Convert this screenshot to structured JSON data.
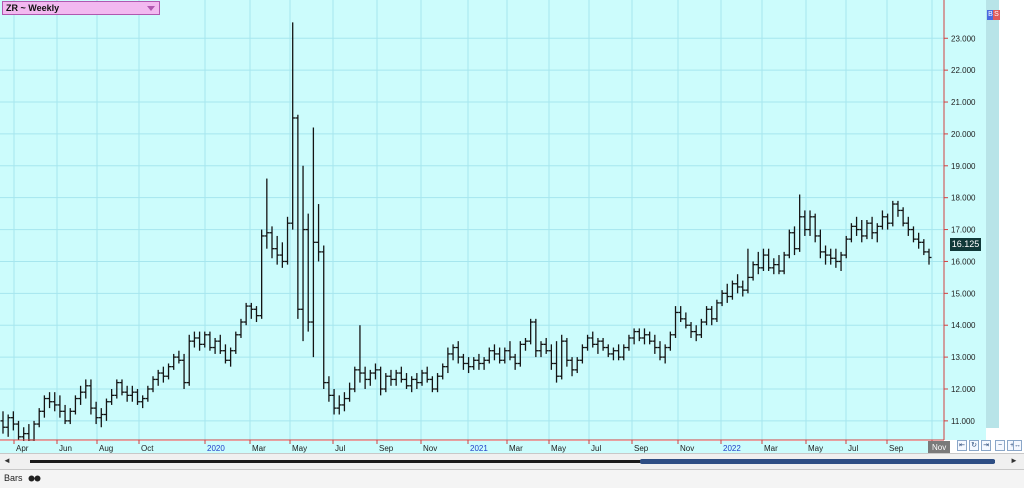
{
  "window": {
    "title": "ZR ~ Weekly"
  },
  "price_marker": {
    "value_label": "16.125",
    "badge_color": "#103838"
  },
  "corner_badges": [
    "B",
    "S"
  ],
  "x_axis_labels": [
    "Apr",
    "Jun",
    "Aug",
    "Oct",
    "2020",
    "Mar",
    "May",
    "Jul",
    "Sep",
    "Nov",
    "2021",
    "Mar",
    "May",
    "Jul",
    "Sep",
    "Nov",
    "2022",
    "Mar",
    "May",
    "Jul",
    "Sep",
    "Nov"
  ],
  "bottom": {
    "tab_label": "Bars",
    "tab_icon": "binoculars-icon"
  },
  "scrollbar": {
    "left_arrow": "◄",
    "right_arrow": "►"
  },
  "nav_buttons": [
    {
      "icon": "step-back-icon",
      "glyph": "⇤"
    },
    {
      "icon": "refresh-icon",
      "glyph": "↻"
    },
    {
      "icon": "step-forward-icon",
      "glyph": "⇥"
    },
    {
      "icon": "zoom-out-icon",
      "glyph": "−"
    },
    {
      "icon": "zoom-in-icon",
      "glyph": "+"
    },
    {
      "icon": "fit-icon",
      "glyph": "↔"
    }
  ],
  "colors": {
    "plot_bg": "#ccfcfc",
    "grid": "#a6e6ee",
    "bar": "#141414",
    "axis_red": "#d04040",
    "year_label": "#2040c8",
    "label": "#222222",
    "price_scale_bg": "#ccfcfc",
    "right_panel": "#b8e4e8"
  },
  "chart_data": {
    "type": "ohlc-bar",
    "title": "ZR ~ Weekly",
    "ylim": [
      10.4,
      24.2
    ],
    "y_ticks": [
      "11.000",
      "12.000",
      "13.000",
      "14.000",
      "15.000",
      "16.000",
      "17.000",
      "18.000",
      "19.000",
      "20.000",
      "21.000",
      "22.000",
      "23.000"
    ],
    "x_ticks": [
      "Apr",
      "Jun",
      "Aug",
      "Oct",
      "2020",
      "Mar",
      "May",
      "Jul",
      "Sep",
      "Nov",
      "2021",
      "Mar",
      "May",
      "Jul",
      "Sep",
      "Nov",
      "2022",
      "Mar",
      "May",
      "Jul",
      "Sep",
      "Nov"
    ],
    "last_price": 16.125,
    "bars": [
      [
        11.0,
        11.3,
        10.6,
        10.8
      ],
      [
        10.8,
        11.2,
        10.5,
        11.1
      ],
      [
        11.1,
        11.3,
        10.7,
        10.9
      ],
      [
        10.9,
        11.0,
        10.4,
        10.5
      ],
      [
        10.5,
        10.8,
        10.2,
        10.6
      ],
      [
        10.6,
        10.9,
        10.3,
        10.4
      ],
      [
        10.4,
        11.0,
        10.3,
        10.9
      ],
      [
        10.9,
        11.4,
        10.8,
        11.3
      ],
      [
        11.3,
        11.8,
        11.1,
        11.7
      ],
      [
        11.7,
        11.9,
        11.4,
        11.6
      ],
      [
        11.6,
        11.9,
        11.3,
        11.5
      ],
      [
        11.5,
        11.8,
        11.1,
        11.3
      ],
      [
        11.3,
        11.5,
        10.9,
        11.0
      ],
      [
        11.0,
        11.4,
        10.9,
        11.3
      ],
      [
        11.3,
        11.8,
        11.2,
        11.7
      ],
      [
        11.7,
        12.1,
        11.5,
        11.9
      ],
      [
        11.9,
        12.3,
        11.7,
        12.1
      ],
      [
        12.1,
        12.3,
        11.2,
        11.4
      ],
      [
        11.4,
        11.6,
        10.9,
        11.1
      ],
      [
        11.1,
        11.4,
        10.8,
        11.2
      ],
      [
        11.2,
        11.7,
        11.0,
        11.6
      ],
      [
        11.6,
        12.0,
        11.5,
        11.8
      ],
      [
        11.8,
        12.3,
        11.7,
        12.2
      ],
      [
        12.2,
        12.3,
        11.8,
        11.9
      ],
      [
        11.9,
        12.1,
        11.6,
        11.8
      ],
      [
        11.8,
        12.1,
        11.6,
        11.9
      ],
      [
        11.9,
        12.0,
        11.5,
        11.6
      ],
      [
        11.6,
        11.8,
        11.4,
        11.7
      ],
      [
        11.7,
        12.1,
        11.6,
        12.0
      ],
      [
        12.0,
        12.4,
        11.9,
        12.3
      ],
      [
        12.3,
        12.6,
        12.1,
        12.5
      ],
      [
        12.5,
        12.7,
        12.2,
        12.4
      ],
      [
        12.4,
        12.8,
        12.3,
        12.7
      ],
      [
        12.7,
        13.1,
        12.6,
        13.0
      ],
      [
        13.0,
        13.2,
        12.8,
        12.9
      ],
      [
        12.9,
        13.1,
        12.0,
        12.2
      ],
      [
        12.2,
        13.7,
        12.1,
        13.5
      ],
      [
        13.5,
        13.8,
        13.3,
        13.6
      ],
      [
        13.6,
        13.8,
        13.2,
        13.4
      ],
      [
        13.4,
        13.8,
        13.3,
        13.7
      ],
      [
        13.7,
        13.8,
        13.2,
        13.3
      ],
      [
        13.3,
        13.6,
        13.1,
        13.5
      ],
      [
        13.5,
        13.7,
        13.1,
        13.2
      ],
      [
        13.2,
        13.4,
        12.8,
        12.9
      ],
      [
        12.9,
        13.3,
        12.7,
        13.2
      ],
      [
        13.2,
        13.8,
        13.1,
        13.7
      ],
      [
        13.7,
        14.2,
        13.6,
        14.1
      ],
      [
        14.1,
        14.7,
        14.0,
        14.6
      ],
      [
        14.6,
        14.7,
        14.2,
        14.5
      ],
      [
        14.5,
        14.6,
        14.1,
        14.3
      ],
      [
        14.3,
        17.0,
        14.2,
        16.8
      ],
      [
        16.8,
        18.6,
        16.4,
        16.9
      ],
      [
        16.9,
        17.1,
        16.1,
        16.4
      ],
      [
        16.4,
        16.8,
        15.9,
        16.2
      ],
      [
        16.2,
        16.6,
        15.8,
        16.0
      ],
      [
        16.0,
        17.4,
        15.9,
        17.2
      ],
      [
        17.2,
        23.5,
        17.0,
        20.5
      ],
      [
        20.5,
        20.6,
        14.2,
        14.5
      ],
      [
        14.5,
        19.0,
        13.5,
        17.0
      ],
      [
        17.0,
        17.5,
        13.8,
        14.1
      ],
      [
        14.1,
        20.2,
        13.0,
        16.6
      ],
      [
        16.6,
        17.8,
        16.0,
        16.3
      ],
      [
        16.3,
        16.5,
        12.0,
        12.2
      ],
      [
        12.2,
        12.4,
        11.6,
        11.8
      ],
      [
        11.8,
        12.0,
        11.2,
        11.4
      ],
      [
        11.4,
        11.8,
        11.2,
        11.5
      ],
      [
        11.5,
        11.9,
        11.3,
        11.7
      ],
      [
        11.7,
        12.2,
        11.6,
        12.0
      ],
      [
        12.0,
        12.7,
        11.9,
        12.6
      ],
      [
        12.6,
        14.0,
        12.2,
        12.5
      ],
      [
        12.5,
        12.7,
        12.0,
        12.3
      ],
      [
        12.3,
        12.6,
        12.1,
        12.5
      ],
      [
        12.5,
        12.8,
        12.3,
        12.6
      ],
      [
        12.6,
        12.7,
        11.8,
        12.0
      ],
      [
        12.0,
        12.5,
        11.9,
        12.4
      ],
      [
        12.4,
        12.6,
        12.1,
        12.3
      ],
      [
        12.3,
        12.6,
        12.1,
        12.5
      ],
      [
        12.5,
        12.7,
        12.2,
        12.3
      ],
      [
        12.3,
        12.5,
        12.0,
        12.1
      ],
      [
        12.1,
        12.4,
        11.9,
        12.3
      ],
      [
        12.3,
        12.5,
        12.0,
        12.2
      ],
      [
        12.2,
        12.6,
        12.1,
        12.5
      ],
      [
        12.5,
        12.7,
        12.2,
        12.3
      ],
      [
        12.3,
        12.4,
        11.9,
        12.0
      ],
      [
        12.0,
        12.5,
        11.9,
        12.4
      ],
      [
        12.4,
        12.8,
        12.3,
        12.7
      ],
      [
        12.7,
        13.3,
        12.5,
        13.1
      ],
      [
        13.1,
        13.4,
        12.9,
        13.3
      ],
      [
        13.3,
        13.5,
        12.8,
        13.0
      ],
      [
        13.0,
        13.1,
        12.6,
        12.8
      ],
      [
        12.8,
        13.0,
        12.5,
        12.7
      ],
      [
        12.7,
        13.0,
        12.6,
        12.9
      ],
      [
        12.9,
        13.1,
        12.6,
        12.8
      ],
      [
        12.8,
        13.0,
        12.6,
        12.9
      ],
      [
        12.9,
        13.3,
        12.8,
        13.2
      ],
      [
        13.2,
        13.4,
        12.9,
        13.1
      ],
      [
        13.1,
        13.3,
        12.8,
        12.9
      ],
      [
        12.9,
        13.3,
        12.8,
        13.2
      ],
      [
        13.2,
        13.5,
        12.9,
        13.0
      ],
      [
        13.0,
        13.1,
        12.6,
        12.8
      ],
      [
        12.8,
        13.5,
        12.7,
        13.4
      ],
      [
        13.4,
        13.6,
        13.2,
        13.5
      ],
      [
        13.5,
        14.2,
        13.4,
        14.1
      ],
      [
        14.1,
        14.2,
        13.0,
        13.2
      ],
      [
        13.2,
        13.5,
        13.0,
        13.4
      ],
      [
        13.4,
        13.6,
        13.1,
        13.2
      ],
      [
        13.2,
        13.4,
        12.6,
        12.8
      ],
      [
        12.8,
        13.5,
        12.2,
        12.4
      ],
      [
        12.4,
        13.7,
        12.3,
        13.5
      ],
      [
        13.5,
        13.6,
        12.7,
        12.9
      ],
      [
        12.9,
        13.0,
        12.4,
        12.6
      ],
      [
        12.6,
        13.0,
        12.5,
        12.9
      ],
      [
        12.9,
        13.4,
        12.8,
        13.3
      ],
      [
        13.3,
        13.7,
        13.2,
        13.6
      ],
      [
        13.6,
        13.8,
        13.3,
        13.4
      ],
      [
        13.4,
        13.6,
        13.1,
        13.5
      ],
      [
        13.5,
        13.6,
        13.2,
        13.3
      ],
      [
        13.3,
        13.4,
        13.0,
        13.1
      ],
      [
        13.1,
        13.3,
        12.9,
        13.2
      ],
      [
        13.2,
        13.4,
        12.9,
        13.0
      ],
      [
        13.0,
        13.4,
        12.9,
        13.3
      ],
      [
        13.3,
        13.7,
        13.2,
        13.6
      ],
      [
        13.6,
        13.9,
        13.4,
        13.8
      ],
      [
        13.8,
        13.9,
        13.5,
        13.6
      ],
      [
        13.6,
        13.9,
        13.4,
        13.7
      ],
      [
        13.7,
        13.8,
        13.4,
        13.5
      ],
      [
        13.5,
        13.7,
        13.1,
        13.3
      ],
      [
        13.3,
        13.5,
        12.9,
        13.0
      ],
      [
        13.0,
        13.4,
        12.8,
        13.3
      ],
      [
        13.3,
        13.8,
        13.2,
        13.7
      ],
      [
        13.7,
        14.6,
        13.6,
        14.4
      ],
      [
        14.4,
        14.6,
        14.1,
        14.2
      ],
      [
        14.2,
        14.4,
        13.9,
        14.0
      ],
      [
        14.0,
        14.1,
        13.6,
        13.8
      ],
      [
        13.8,
        14.0,
        13.5,
        13.7
      ],
      [
        13.7,
        14.2,
        13.6,
        14.1
      ],
      [
        14.1,
        14.6,
        14.0,
        14.5
      ],
      [
        14.5,
        14.6,
        14.0,
        14.2
      ],
      [
        14.2,
        14.8,
        14.1,
        14.7
      ],
      [
        14.7,
        15.1,
        14.6,
        15.0
      ],
      [
        15.0,
        15.3,
        14.7,
        14.9
      ],
      [
        14.9,
        15.4,
        14.8,
        15.3
      ],
      [
        15.3,
        15.6,
        15.0,
        15.2
      ],
      [
        15.2,
        15.4,
        14.9,
        15.1
      ],
      [
        15.1,
        16.4,
        15.0,
        15.5
      ],
      [
        15.5,
        16.0,
        15.4,
        15.9
      ],
      [
        15.9,
        16.3,
        15.6,
        15.8
      ],
      [
        15.8,
        16.4,
        15.7,
        16.2
      ],
      [
        16.2,
        16.4,
        15.7,
        15.8
      ],
      [
        15.8,
        16.1,
        15.6,
        15.9
      ],
      [
        15.9,
        16.2,
        15.6,
        15.7
      ],
      [
        15.7,
        16.3,
        15.6,
        16.2
      ],
      [
        16.2,
        17.0,
        16.1,
        16.9
      ],
      [
        16.9,
        17.1,
        16.2,
        16.4
      ],
      [
        16.4,
        18.1,
        16.3,
        17.4
      ],
      [
        17.4,
        17.6,
        16.8,
        17.0
      ],
      [
        17.0,
        17.6,
        16.8,
        17.4
      ],
      [
        17.4,
        17.5,
        16.6,
        16.8
      ],
      [
        16.8,
        17.0,
        16.1,
        16.3
      ],
      [
        16.3,
        16.5,
        15.9,
        16.2
      ],
      [
        16.2,
        16.4,
        15.9,
        16.1
      ],
      [
        16.1,
        16.4,
        15.8,
        16.0
      ],
      [
        16.0,
        16.3,
        15.7,
        16.2
      ],
      [
        16.2,
        16.8,
        16.1,
        16.7
      ],
      [
        16.7,
        17.2,
        16.6,
        17.1
      ],
      [
        17.1,
        17.4,
        16.8,
        17.0
      ],
      [
        17.0,
        17.3,
        16.6,
        16.8
      ],
      [
        16.8,
        17.3,
        16.7,
        17.2
      ],
      [
        17.2,
        17.4,
        16.7,
        16.9
      ],
      [
        16.9,
        17.2,
        16.6,
        17.1
      ],
      [
        17.1,
        17.6,
        17.0,
        17.4
      ],
      [
        17.4,
        17.5,
        17.0,
        17.2
      ],
      [
        17.2,
        17.9,
        17.1,
        17.8
      ],
      [
        17.8,
        17.9,
        17.4,
        17.6
      ],
      [
        17.6,
        17.7,
        17.1,
        17.2
      ],
      [
        17.2,
        17.4,
        16.8,
        17.0
      ],
      [
        17.0,
        17.1,
        16.6,
        16.7
      ],
      [
        16.7,
        16.9,
        16.4,
        16.6
      ],
      [
        16.6,
        16.7,
        16.2,
        16.3
      ],
      [
        16.3,
        16.4,
        15.9,
        16.125
      ]
    ]
  }
}
